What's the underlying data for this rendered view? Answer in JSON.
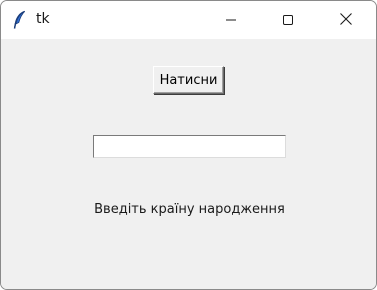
{
  "window": {
    "title": "tk"
  },
  "titlebar": {
    "app_icon": "tk-feather-icon",
    "buttons": [
      "minimize-icon",
      "maximize-icon",
      "close-icon"
    ]
  },
  "main": {
    "button_label": "Натисни",
    "entry_value": "",
    "entry_placeholder": "",
    "label_text": "Введіть країну народження"
  },
  "colors": {
    "window_bg": "#f0f0f0",
    "titlebar_bg": "#ffffff",
    "feather_blue": "#2f6fd6"
  }
}
